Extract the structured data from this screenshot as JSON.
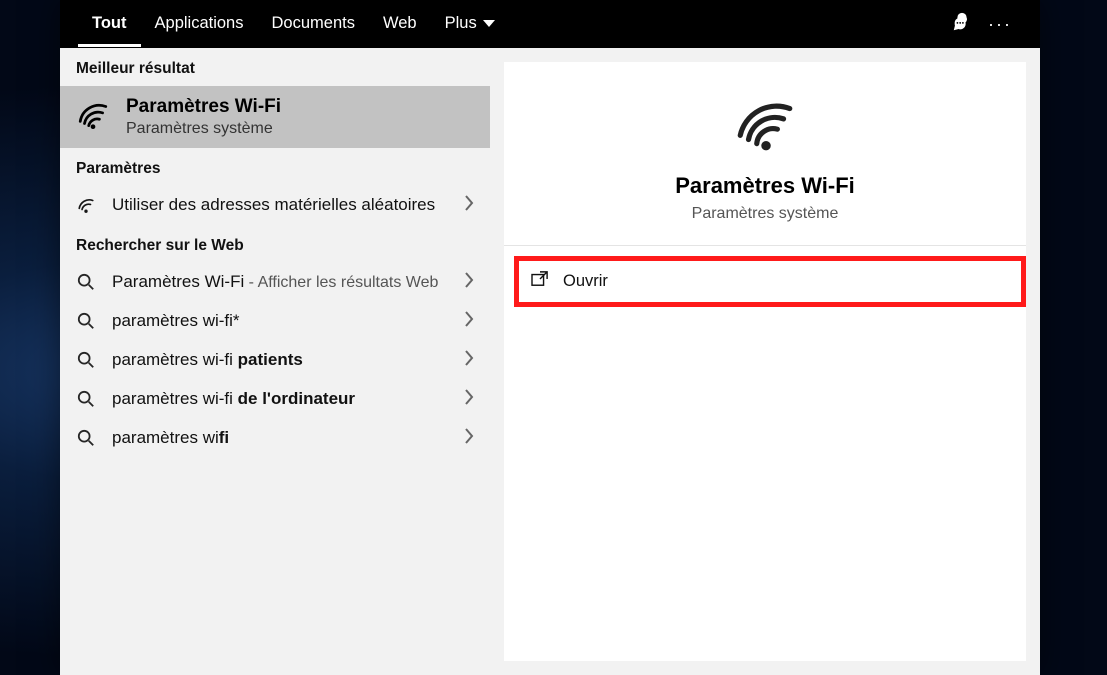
{
  "tabs": {
    "all": "Tout",
    "apps": "Applications",
    "docs": "Documents",
    "web": "Web",
    "more": "Plus"
  },
  "sections": {
    "best": "Meilleur résultat",
    "settings": "Paramètres",
    "web": "Rechercher sur le Web"
  },
  "best": {
    "title": "Paramètres Wi-Fi",
    "subtitle": "Paramètres système"
  },
  "settings_items": [
    {
      "label": "Utiliser des adresses matérielles aléatoires"
    }
  ],
  "web_items": [
    {
      "prefix": "Paramètres Wi-Fi",
      "suffix": " - Afficher les résultats Web",
      "muted_suffix": true
    },
    {
      "prefix": "paramètres wi-fi*",
      "bold": ""
    },
    {
      "prefix": "paramètres wi-fi ",
      "bold": "patients"
    },
    {
      "prefix": "paramètres wi-fi ",
      "bold": "de l'ordinateur"
    },
    {
      "prefix": "paramètres wi",
      "bold": "fi"
    }
  ],
  "preview": {
    "title": "Paramètres Wi-Fi",
    "subtitle": "Paramètres système",
    "open": "Ouvrir"
  }
}
